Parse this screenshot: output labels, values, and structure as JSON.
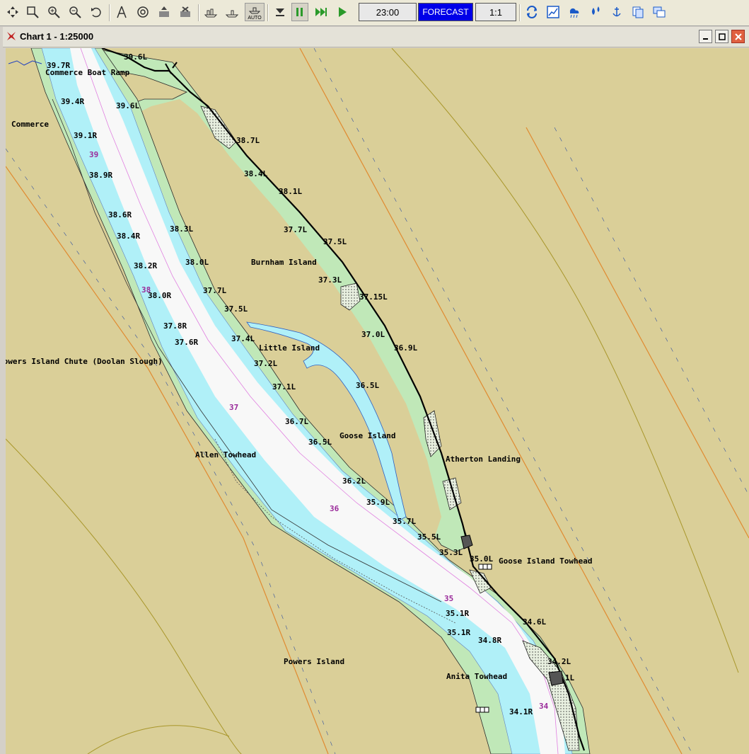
{
  "toolbar": {
    "time": "23:00",
    "forecast_label": "FORECAST",
    "scale_label": "1:1",
    "auto_label": "AUTO"
  },
  "window": {
    "title": "Chart 1 - 1:25000"
  },
  "map": {
    "place_labels": [
      "Commerce Boat Ramp",
      "Commerce",
      "Burnham Island",
      "Little Island",
      "Goose Island",
      "Atherton Landing",
      "Allen Towhead",
      "Goose Island Towhead",
      "Powers Island",
      "Anita Towhead",
      "Powers Island Chute (Doolan Slough)"
    ],
    "mile_markers": [
      "39",
      "38",
      "37",
      "36",
      "35",
      "34"
    ],
    "buoy_labels": [
      "39.6L",
      "39.7R",
      "39.4R",
      "39.6L",
      "39.1R",
      "38.7L",
      "38.9R",
      "38.4L",
      "38.1L",
      "38.6R",
      "38.4R",
      "38.3L",
      "37.7L",
      "37.5L",
      "38.2R",
      "38.0L",
      "37.3L",
      "38.0R",
      "37.15L",
      "37.7L",
      "37.5L",
      "37.8R",
      "37.6R",
      "37.4L",
      "37.2L",
      "37.0L",
      "36.9L",
      "37.1L",
      "36.5L",
      "36.7L",
      "36.5L",
      "36.2L",
      "35.9L",
      "35.7L",
      "35.5L",
      "35.3L",
      "35.0L",
      "35.1R",
      "35.1R",
      "34.8R",
      "34.6L",
      "34.2L",
      "34.1L",
      "34.1R"
    ]
  },
  "colors": {
    "land": "#dacf98",
    "shore_green": "#c0e8b8",
    "shallow_water": "#b0f0f8",
    "channel": "#f8f8f8",
    "forecast_bg": "#0000e8",
    "mile_marker": "#9a2a9a",
    "titlebar": "#e4e2d8"
  }
}
